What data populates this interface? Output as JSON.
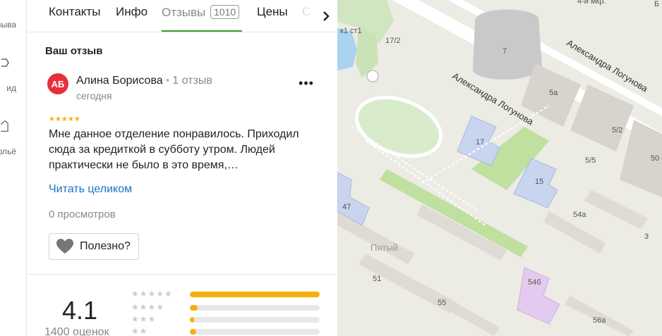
{
  "rail": {
    "items": [
      {
        "label": "отзыва",
        "icon": "review-icon"
      },
      {
        "label": "ид",
        "icon": "star-outline-icon"
      },
      {
        "label": "рльё",
        "icon": "house-icon"
      }
    ]
  },
  "tabs": [
    {
      "label": "Контакты"
    },
    {
      "label": "Инфо"
    },
    {
      "label": "Отзывы",
      "count": "1010",
      "active": true
    },
    {
      "label": "Цены"
    },
    {
      "label": "С"
    }
  ],
  "review_section": {
    "title": "Ваш отзыв",
    "avatar_initials": "АБ",
    "avatar_color": "#e8303b",
    "author_name": "Алина Борисова",
    "separator": "•",
    "author_reviews": "1 отзыв",
    "date": "сегодня",
    "rating_stars": "★★★★★",
    "rating": 5,
    "text": "Мне данное отделение понравилось. Приходил сюда за кредиткой в субботу утром. Людей практически не было в это время,…",
    "read_more": "Читать целиком",
    "views": "0 просмотров",
    "useful_label": "Полезно?"
  },
  "summary": {
    "score": "4.1",
    "count_label": "1400 оценок",
    "distribution": [
      {
        "stars": "★★★★★",
        "fraction": 1.0
      },
      {
        "stars": "★★★★",
        "fraction": 0.06
      },
      {
        "stars": "★★★",
        "fraction": 0.03
      },
      {
        "stars": "★★",
        "fraction": 0.05
      }
    ]
  },
  "map": {
    "streets": [
      {
        "name": "Александра Логунова"
      },
      {
        "name": "Александра Логунова"
      }
    ],
    "labels": [
      "к1 ст1",
      "17/2",
      "7",
      "5а",
      "5/2",
      "17",
      "15",
      "5/5",
      "47",
      "54а",
      "3",
      "Пятый",
      "51",
      "55",
      "54б",
      "56а",
      "50",
      "4-й мкр.",
      "Б"
    ]
  },
  "colors": {
    "accent_green": "#3a9d2e",
    "star_gold": "#f5b10a",
    "link_blue": "#1a73c8"
  }
}
